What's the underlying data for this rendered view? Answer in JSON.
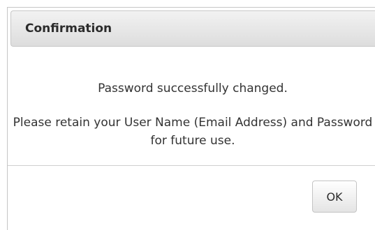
{
  "dialog": {
    "title": "Confirmation",
    "message_line1": "Password successfully changed.",
    "message_line2": "Please retain your User Name (Email Address) and Password for future use.",
    "ok_label": "OK"
  }
}
